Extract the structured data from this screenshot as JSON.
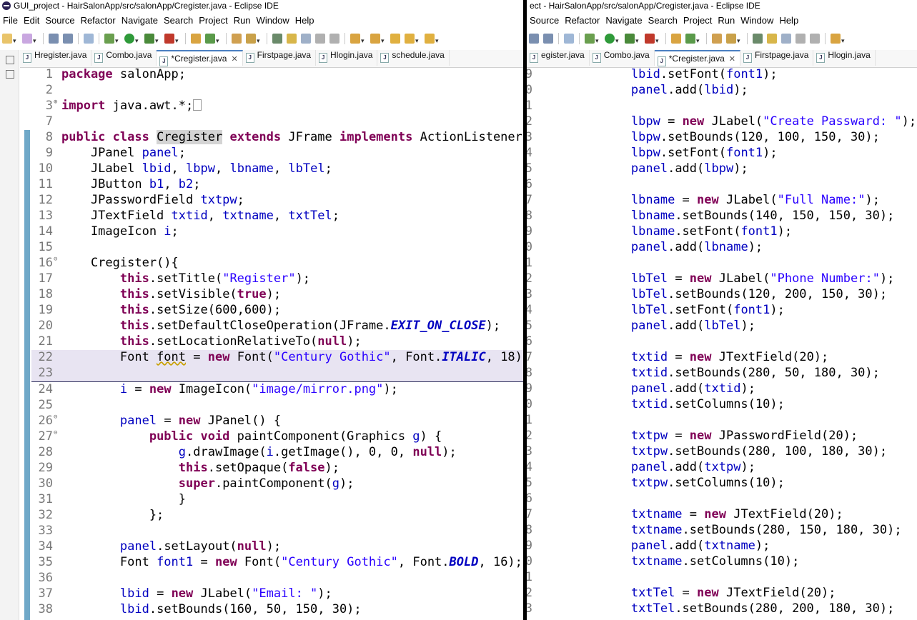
{
  "left_window": {
    "title": "GUI_project - HairSalonApp/src/salonApp/Cregister.java - Eclipse IDE",
    "menu": [
      "File",
      "Edit",
      "Source",
      "Refactor",
      "Navigate",
      "Search",
      "Project",
      "Run",
      "Window",
      "Help"
    ],
    "tabs": [
      {
        "label": "Hregister.java",
        "active": false
      },
      {
        "label": "Combo.java",
        "active": false
      },
      {
        "label": "*Cregister.java",
        "active": true
      },
      {
        "label": "Firstpage.java",
        "active": false
      },
      {
        "label": "Hlogin.java",
        "active": false
      },
      {
        "label": "schedule.java",
        "active": false
      }
    ],
    "close_glyph": "✕"
  },
  "right_window": {
    "title": "ect - HairSalonApp/src/salonApp/Cregister.java - Eclipse IDE",
    "menu": [
      "Source",
      "Refactor",
      "Navigate",
      "Search",
      "Project",
      "Run",
      "Window",
      "Help"
    ],
    "tabs": [
      {
        "label": "egister.java",
        "active": false
      },
      {
        "label": "Combo.java",
        "active": false
      },
      {
        "label": "*Cregister.java",
        "active": true
      },
      {
        "label": "Firstpage.java",
        "active": false
      },
      {
        "label": "Hlogin.java",
        "active": false
      }
    ],
    "close_glyph": "✕"
  },
  "colors": {
    "keyword": "#7f0055",
    "string": "#2a00ff",
    "field": "#0000c0",
    "line_number": "#787878",
    "active_tab_border": "#4a7fc1"
  }
}
